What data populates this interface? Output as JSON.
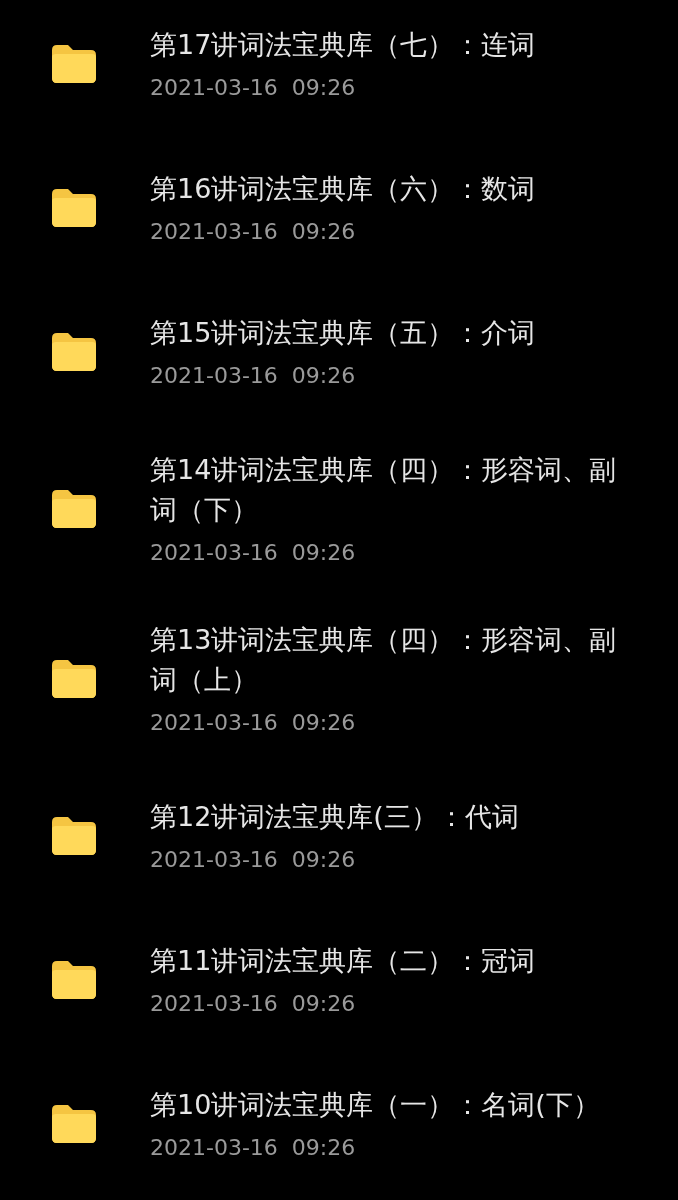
{
  "files": [
    {
      "kind": "folder",
      "name": "第17讲词法宝典库（七）：连词",
      "modified": "2021-03-16  09:26"
    },
    {
      "kind": "folder",
      "name": "第16讲词法宝典库（六）：数词",
      "modified": "2021-03-16  09:26"
    },
    {
      "kind": "folder",
      "name": "第15讲词法宝典库（五）：介词",
      "modified": "2021-03-16  09:26"
    },
    {
      "kind": "folder",
      "name": "第14讲词法宝典库（四）：形容词、副词（下）",
      "modified": "2021-03-16  09:26"
    },
    {
      "kind": "folder",
      "name": "第13讲词法宝典库（四）：形容词、副词（上）",
      "modified": "2021-03-16  09:26"
    },
    {
      "kind": "folder",
      "name": "第12讲词法宝典库(三）：代词",
      "modified": "2021-03-16  09:26"
    },
    {
      "kind": "folder",
      "name": "第11讲词法宝典库（二）：冠词",
      "modified": "2021-03-16  09:26"
    },
    {
      "kind": "folder",
      "name": "第10讲词法宝典库（一）：名词(下）",
      "modified": "2021-03-16  09:26"
    }
  ]
}
